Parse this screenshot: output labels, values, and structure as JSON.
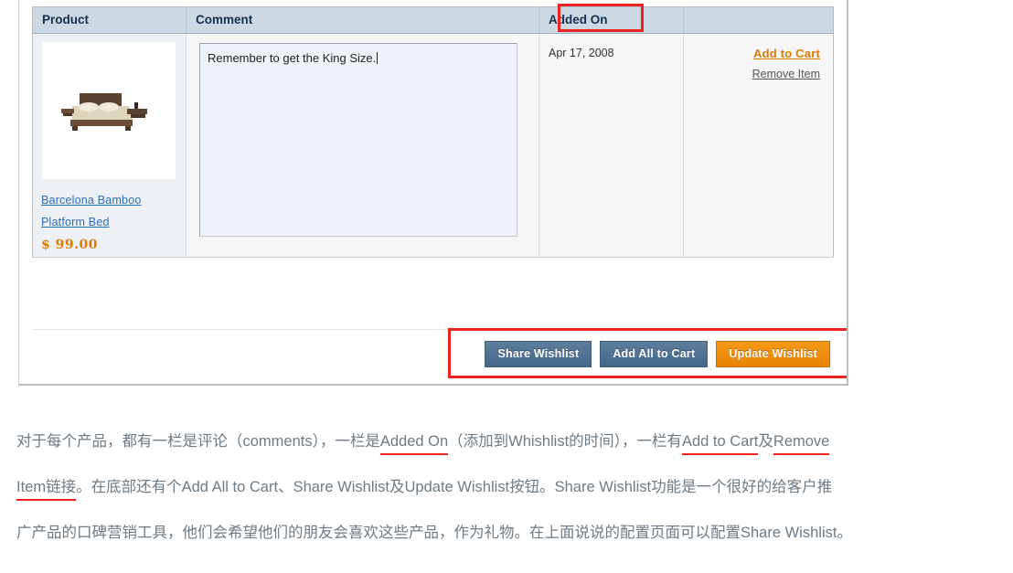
{
  "screenshot": {
    "table": {
      "headers": [
        "Product",
        "Comment",
        "Added On",
        ""
      ],
      "row": {
        "product": {
          "image_alt": "platform-bed-thumbnail",
          "link_line1": "Barcelona Bamboo",
          "link_line2": "Platform Bed",
          "price": "$ 99.00"
        },
        "comment": {
          "value": "Remember to get the King Size.",
          "placeholder": "Comment"
        },
        "added_on": "Apr 17, 2008",
        "actions": {
          "add_to_cart": "Add to Cart",
          "remove_item": "Remove Item"
        }
      }
    },
    "buttons": {
      "share": "Share Wishlist",
      "add_all": "Add All to Cart",
      "update": "Update Wishlist"
    },
    "colors": {
      "header_bg": "#ccd9e5",
      "header_text": "#14304f",
      "link_blue": "#2a6ebb",
      "price_orange": "#e07b00",
      "button_blue": "#517291",
      "button_orange": "#ef8c08",
      "annotation_red": "#ef2222"
    }
  },
  "caption": {
    "line1": {
      "a": "对于每个产品，都有一栏是评论（comments），一栏是",
      "b_underlined": "Added On",
      "c": "（添加到Whishlist的时间），一栏有",
      "d_underlined": "Add to Cart",
      "e": "及",
      "f_underlined": "Remove"
    },
    "line2": {
      "a_underlined": "Item链接",
      "b": "。在底部还有个Add All to Cart、Share Wishlist及Update Wishlist按钮。Share Wishlist功能是一个很好的给客户推"
    },
    "line3": "广产品的口碑营销工具，他们会希望他们的朋友会喜欢这些产品，作为礼物。在上面说说的配置页面可以配置Share Wishlist。"
  }
}
